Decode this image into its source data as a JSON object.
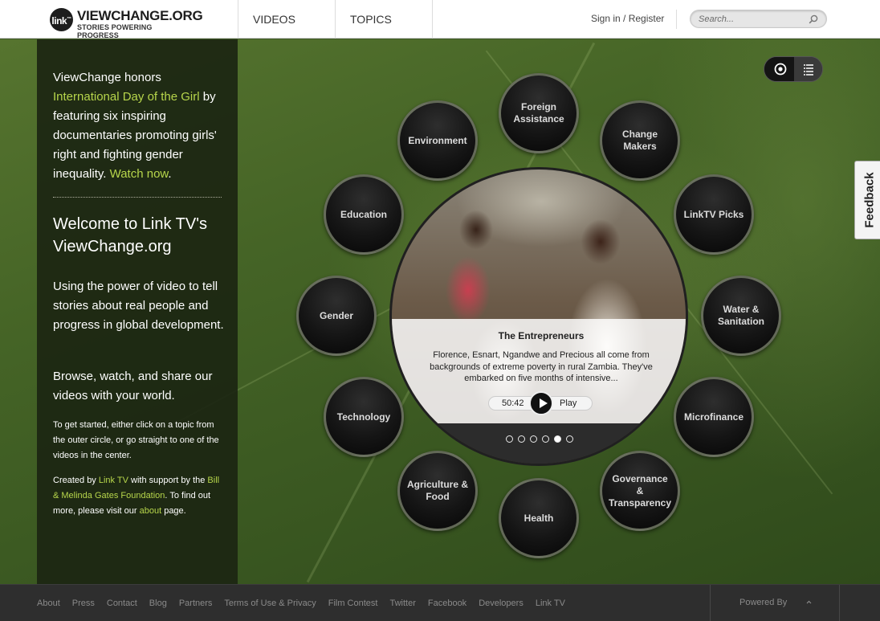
{
  "header": {
    "logo_badge": "link",
    "logo_title": "VIEWCHANGE.ORG",
    "logo_tagline": "STORIES POWERING PROGRESS",
    "nav": [
      "VIDEOS",
      "TOPICS"
    ],
    "sign_in": "Sign in",
    "slash": " / ",
    "register": "Register",
    "search_placeholder": "Search..."
  },
  "left_panel": {
    "intro_pre": "ViewChange honors ",
    "intro_link": "International Day of the Girl",
    "intro_mid": " by featuring six inspiring documentaries promoting girls' right and fighting gender inequality. ",
    "intro_watch": "Watch now",
    "intro_end": ".",
    "welcome": "Welcome to Link TV's ViewChange.org",
    "para1": "Using the power of video to tell stories about real people and progress in global development.",
    "para2": "Browse, watch, and share our videos with your world.",
    "small1": "To get started, either click on a topic from the outer circle, or go straight to one of the videos in the center.",
    "small2_a": "Created by ",
    "small2_link1": "Link TV",
    "small2_b": " with support by the ",
    "small2_link2": "Bill & Melinda Gates Foundation",
    "small2_c": ". To find out more, please visit our ",
    "small2_link3": "about",
    "small2_d": " page."
  },
  "topics": [
    "Foreign Assistance",
    "Change Makers",
    "LinkTV Picks",
    "Water & Sanitation",
    "Microfinance",
    "Governance & Transparency",
    "Health",
    "Agriculture & Food",
    "Technology",
    "Gender",
    "Education",
    "Environment"
  ],
  "featured": {
    "title": "The Entrepreneurs",
    "description": "Florence, Esnart, Ngandwe and Precious all come from backgrounds of extreme poverty in rural Zambia. They've embarked on five months of intensive...",
    "duration": "50:42",
    "play_label": "Play",
    "slide_count": 6,
    "active_slide": 5
  },
  "feedback_label": "Feedback",
  "footer": {
    "links": [
      "About",
      "Press",
      "Contact",
      "Blog",
      "Partners",
      "Terms of Use & Privacy",
      "Film Contest",
      "Twitter",
      "Facebook",
      "Developers",
      "Link TV"
    ],
    "powered_by": "Powered By"
  },
  "colors": {
    "accent_green": "#b7d64b",
    "panel_bg": "#1c2612",
    "footer_bg": "#2e2e2e"
  }
}
